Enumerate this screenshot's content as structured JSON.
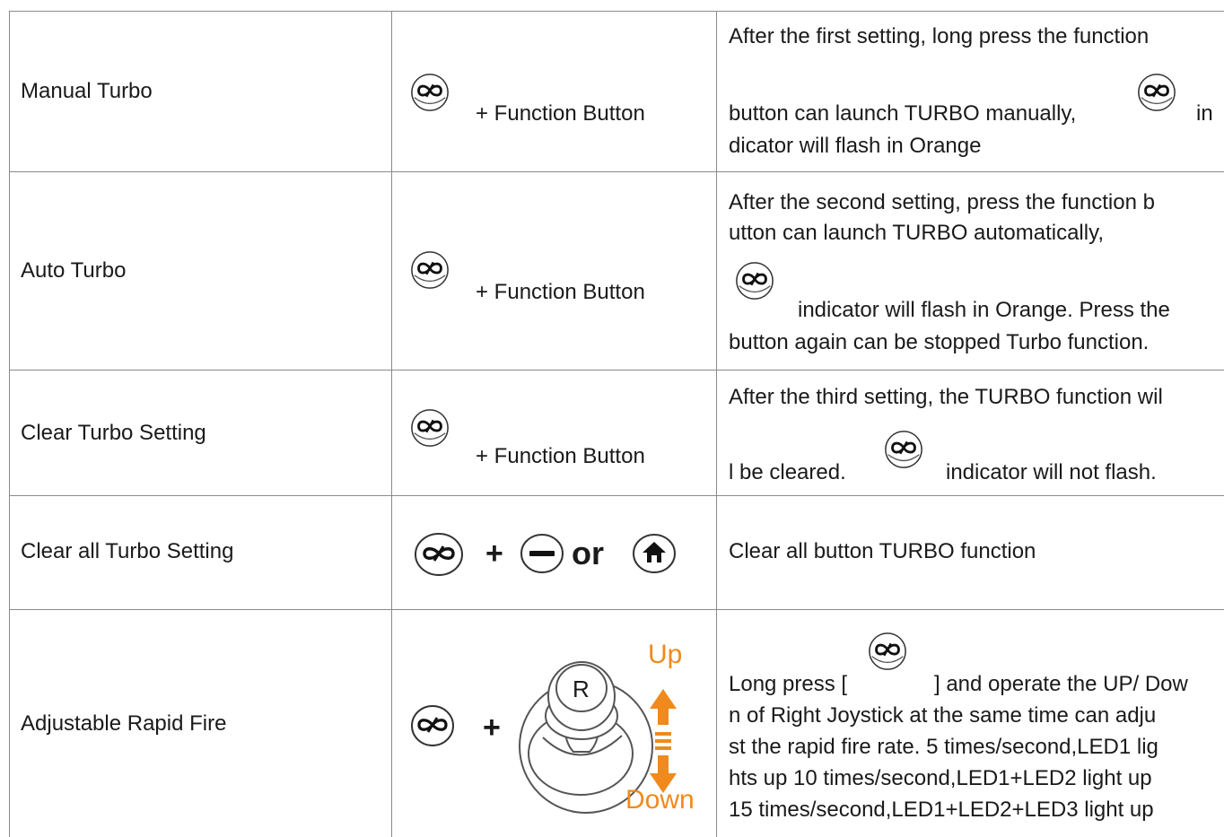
{
  "rows": [
    {
      "name": "Manual Turbo",
      "combo": "+ Function Button",
      "desc": {
        "line1": "After the first setting, long press the function",
        "line2a": "button can launch TURBO manually,",
        "line2b": "in",
        "line3": "dicator will flash in Orange"
      }
    },
    {
      "name": "Auto Turbo",
      "combo": "+ Function Button",
      "desc": {
        "line1": "After the second setting, press the function b",
        "line2": "utton can launch TURBO automatically,",
        "line3": "indicator will flash in Orange. Press the",
        "line4": "button again can be stopped Turbo function."
      }
    },
    {
      "name": "Clear Turbo Setting",
      "combo": "+ Function Button",
      "desc": {
        "line1": "After the third setting, the TURBO function wil",
        "line2a": "l be cleared.",
        "line2b": "indicator will not flash."
      }
    },
    {
      "name": "Clear all Turbo Setting",
      "combo": {
        "plus": "+",
        "or": "or"
      },
      "desc": {
        "line1": "Clear all button TURBO function"
      }
    },
    {
      "name": "Adjustable Rapid Fire",
      "combo": {
        "plus": "+",
        "stick_label": "R",
        "up": "Up",
        "down": "Down"
      },
      "desc": {
        "line1a": "Long press [",
        "line1b": "] and operate the UP/ Dow",
        "line2": "n of Right Joystick at the same time can adju",
        "line3": "st the rapid fire rate. 5 times/second,LED1 lig",
        "line4": "hts up 10 times/second,LED1+LED2 light up",
        "line5": "15 times/second,LED1+LED2+LED3 light up"
      }
    }
  ],
  "icons": {
    "turbo": "turbo-icon",
    "minus": "minus-button-icon",
    "home": "home-button-icon",
    "joystick": "right-joystick-icon",
    "arrows": "up-down-arrow-icon"
  },
  "colors": {
    "accent": "#f08a1c",
    "border": "#8a8a8a"
  }
}
